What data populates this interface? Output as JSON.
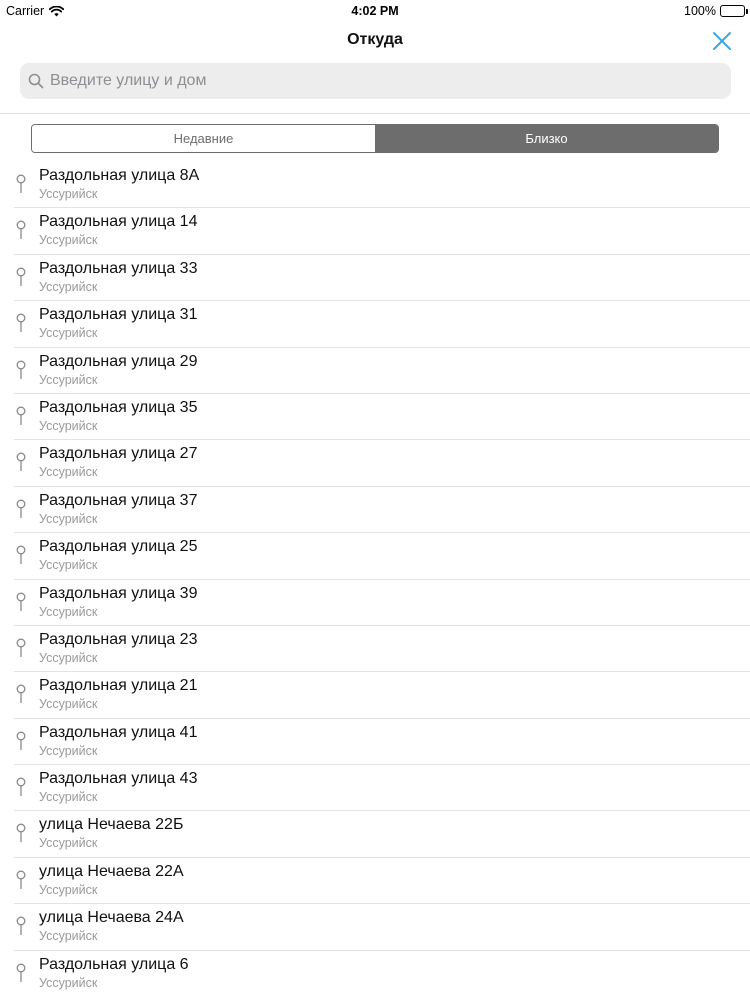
{
  "status_bar": {
    "carrier": "Carrier",
    "time": "4:02 PM",
    "battery": "100%"
  },
  "nav": {
    "title": "Откуда"
  },
  "search": {
    "placeholder": "Введите улицу и дом",
    "value": ""
  },
  "segments": [
    {
      "label": "Недавние",
      "selected": false
    },
    {
      "label": "Близко",
      "selected": true
    }
  ],
  "colors": {
    "accent": "#3aa7e4",
    "segment_active": "#6d6d6d"
  },
  "items": [
    {
      "title": "Раздольная улица 8А",
      "subtitle": "Уссурийск"
    },
    {
      "title": "Раздольная улица 14",
      "subtitle": "Уссурийск"
    },
    {
      "title": "Раздольная улица 33",
      "subtitle": "Уссурийск"
    },
    {
      "title": "Раздольная улица 31",
      "subtitle": "Уссурийск"
    },
    {
      "title": "Раздольная улица 29",
      "subtitle": "Уссурийск"
    },
    {
      "title": "Раздольная улица 35",
      "subtitle": "Уссурийск"
    },
    {
      "title": "Раздольная улица 27",
      "subtitle": "Уссурийск"
    },
    {
      "title": "Раздольная улица 37",
      "subtitle": "Уссурийск"
    },
    {
      "title": "Раздольная улица 25",
      "subtitle": "Уссурийск"
    },
    {
      "title": "Раздольная улица 39",
      "subtitle": "Уссурийск"
    },
    {
      "title": "Раздольная улица 23",
      "subtitle": "Уссурийск"
    },
    {
      "title": "Раздольная улица 21",
      "subtitle": "Уссурийск"
    },
    {
      "title": "Раздольная улица 41",
      "subtitle": "Уссурийск"
    },
    {
      "title": "Раздольная улица 43",
      "subtitle": "Уссурийск"
    },
    {
      "title": "улица Нечаева 22Б",
      "subtitle": "Уссурийск"
    },
    {
      "title": "улица Нечаева 22А",
      "subtitle": "Уссурийск"
    },
    {
      "title": "улица Нечаева 24А",
      "subtitle": "Уссурийск"
    },
    {
      "title": "Раздольная улица 6",
      "subtitle": "Уссурийск"
    }
  ]
}
